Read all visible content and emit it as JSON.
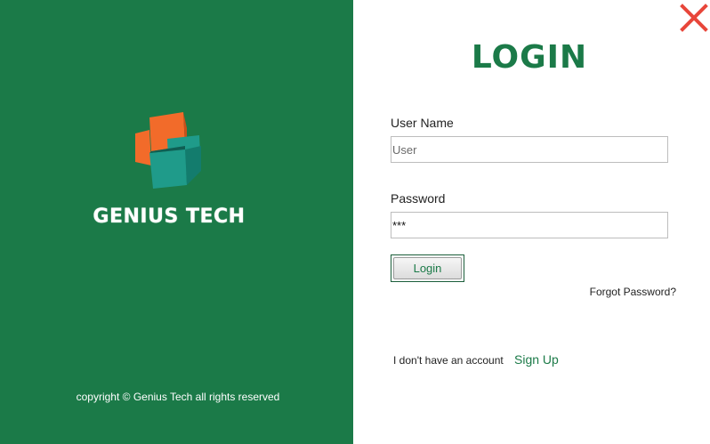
{
  "brand": {
    "name": "GENIUS TECH",
    "copyright": "copyright © Genius Tech all rights reserved",
    "logo_icon": "genius-tech-logo"
  },
  "login": {
    "title": "LOGIN",
    "username_label": "User Name",
    "username_placeholder": "User",
    "username_value": "",
    "password_label": "Password",
    "password_value": "***",
    "login_button": "Login",
    "forgot_password": "Forgot Password?",
    "no_account_text": "I don't have an account",
    "signup_link": "Sign Up"
  },
  "window": {
    "close_icon": "close-icon"
  },
  "colors": {
    "brand_green": "#1b7a48",
    "logo_orange": "#f26b2a",
    "logo_teal": "#1f9b8a",
    "close_red": "#e8463a"
  }
}
